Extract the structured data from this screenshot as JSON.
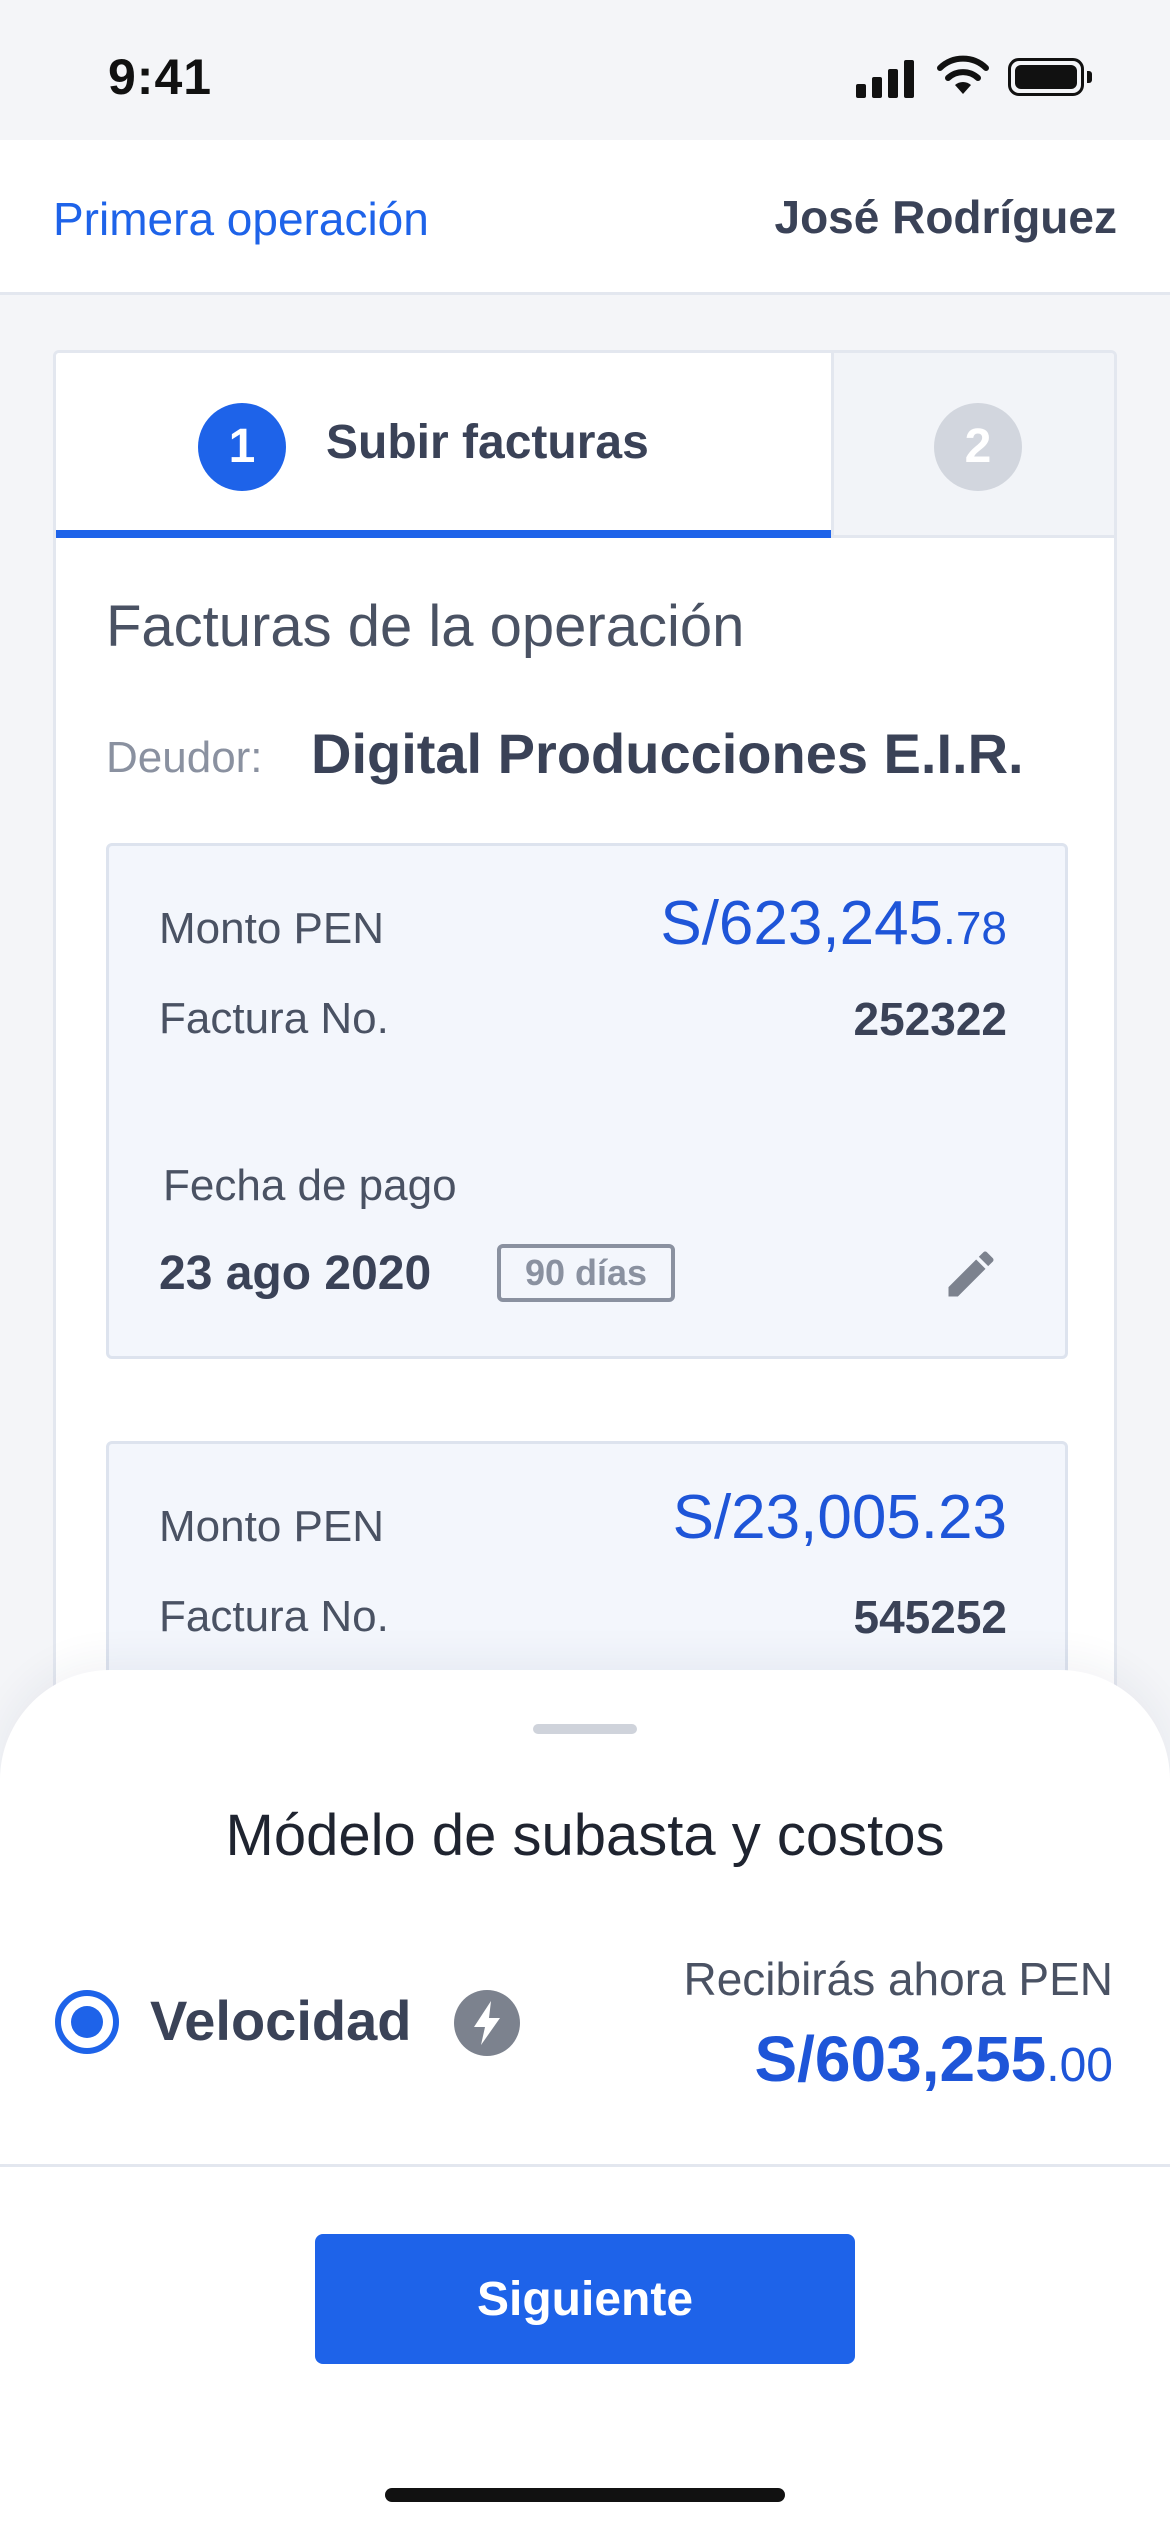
{
  "status_bar": {
    "time": "9:41"
  },
  "header": {
    "link_label": "Primera operación",
    "user_name": "José Rodríguez"
  },
  "stepper": {
    "steps": [
      {
        "number": "1",
        "label": "Subir facturas",
        "active": true
      },
      {
        "number": "2",
        "label": "",
        "active": false
      }
    ]
  },
  "section": {
    "title": "Facturas de la operación",
    "debtor_label": "Deudor:",
    "debtor_name": "Digital Producciones E.I.R."
  },
  "invoices": [
    {
      "amount_label": "Monto PEN",
      "amount_main": "S/623,245",
      "amount_cents": ".78",
      "number_label": "Factura No.",
      "number": "252322",
      "date_label": "Fecha de pago",
      "date": "23 ago 2020",
      "days": "90 días"
    },
    {
      "amount_label": "Monto PEN",
      "amount_main": "S/23,005.23",
      "amount_cents": "",
      "number_label": "Factura No.",
      "number": "545252"
    }
  ],
  "bottom_sheet": {
    "title": "Módelo de subasta y costos",
    "option_label": "Velocidad",
    "option_selected": true,
    "receive_label": "Recibirás ahora PEN",
    "receive_main": "S/603,255",
    "receive_cents": ".00",
    "next_button_label": "Siguiente"
  },
  "icons": {
    "signal": "cellular-signal-icon",
    "wifi": "wifi-icon",
    "battery": "battery-icon",
    "edit": "pencil-icon",
    "bolt": "lightning-bolt-icon"
  },
  "colors": {
    "primary": "#1e63e9",
    "amount": "#1e55d8",
    "text_dark": "#3a4257",
    "text_muted": "#8a91a0",
    "background": "#f4f5f8",
    "invoice_bg": "#f3f6fc"
  }
}
